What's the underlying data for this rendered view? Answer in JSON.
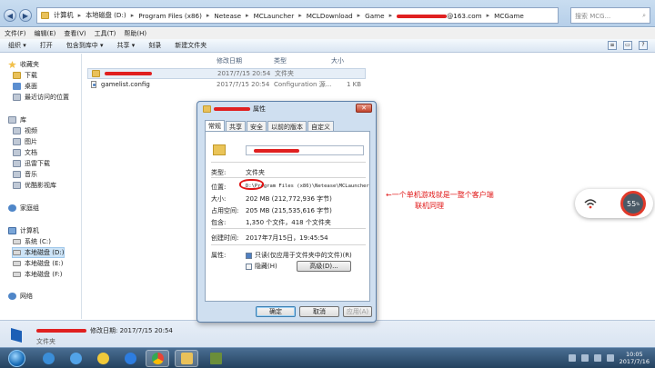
{
  "address": {
    "segments": [
      "计算机",
      "本地磁盘 (D:)",
      "Program Files (x86)",
      "Netease",
      "MCLauncher",
      "MCLDownload",
      "Game",
      "@163.com",
      "MCGame"
    ],
    "search_placeholder": "搜索 MCG..."
  },
  "menu": [
    "文件(F)",
    "编辑(E)",
    "查看(V)",
    "工具(T)",
    "帮助(H)"
  ],
  "toolbar": [
    "组织 ▾",
    "打开",
    "包含到库中 ▾",
    "共享 ▾",
    "刻录",
    "新建文件夹"
  ],
  "nav": {
    "favorites": "收藏夹",
    "fav_items": [
      "下载",
      "桌面",
      "最近访问的位置"
    ],
    "library": "库",
    "lib_items": [
      "视频",
      "图片",
      "文档",
      "迅雷下载",
      "音乐",
      "优酷影视库"
    ],
    "homegroup": "家庭组",
    "computer": "计算机",
    "drives": [
      "系统 (C:)",
      "本地磁盘 (D:)",
      "本地磁盘 (E:)",
      "本地磁盘 (F:)"
    ],
    "network": "网络"
  },
  "columns": {
    "date": "修改日期",
    "type": "类型",
    "size": "大小"
  },
  "files": [
    {
      "name": "",
      "date": "2017/7/15 20:54",
      "type": "文件夹",
      "size": ""
    },
    {
      "name": "gamelist.config",
      "date": "2017/7/15 20:54",
      "type": "Configuration 源...",
      "size": "1 KB"
    }
  ],
  "details": {
    "modified": "修改日期: 2017/7/15 20:54",
    "type": "文件夹"
  },
  "dialog": {
    "title": "属性",
    "tabs": [
      "常规",
      "共享",
      "安全",
      "以前的版本",
      "自定义"
    ],
    "rows": [
      {
        "label": "类型:",
        "value": "文件夹"
      },
      {
        "label": "位置:",
        "value": "D:\\Program Files (x86)\\Netease\\MCLauncher"
      },
      {
        "label": "大小:",
        "value": "202 MB (212,772,936 字节)"
      },
      {
        "label": "占用空间:",
        "value": "205 MB (215,535,616 字节)"
      },
      {
        "label": "包含:",
        "value": "1,350 个文件，418 个文件夹"
      },
      {
        "label": "创建时间:",
        "value": "2017年7月15日，19:45:54"
      }
    ],
    "attr_label": "属性:",
    "readonly": "只读(仅应用于文件夹中的文件)(R)",
    "hidden": "隐藏(H)",
    "advanced": "高级(D)...",
    "ok": "确定",
    "cancel": "取消",
    "apply": "应用(A)"
  },
  "annotation": {
    "line1": "←一个单机游戏就是一整个客户端",
    "line2": "联机同理"
  },
  "widget": {
    "value": "55",
    "unit": "%"
  },
  "clock": {
    "time": "10:05",
    "date": "2017/7/16"
  },
  "colors": {
    "annotation": "#e01515",
    "accent": "#1b6fb9"
  }
}
